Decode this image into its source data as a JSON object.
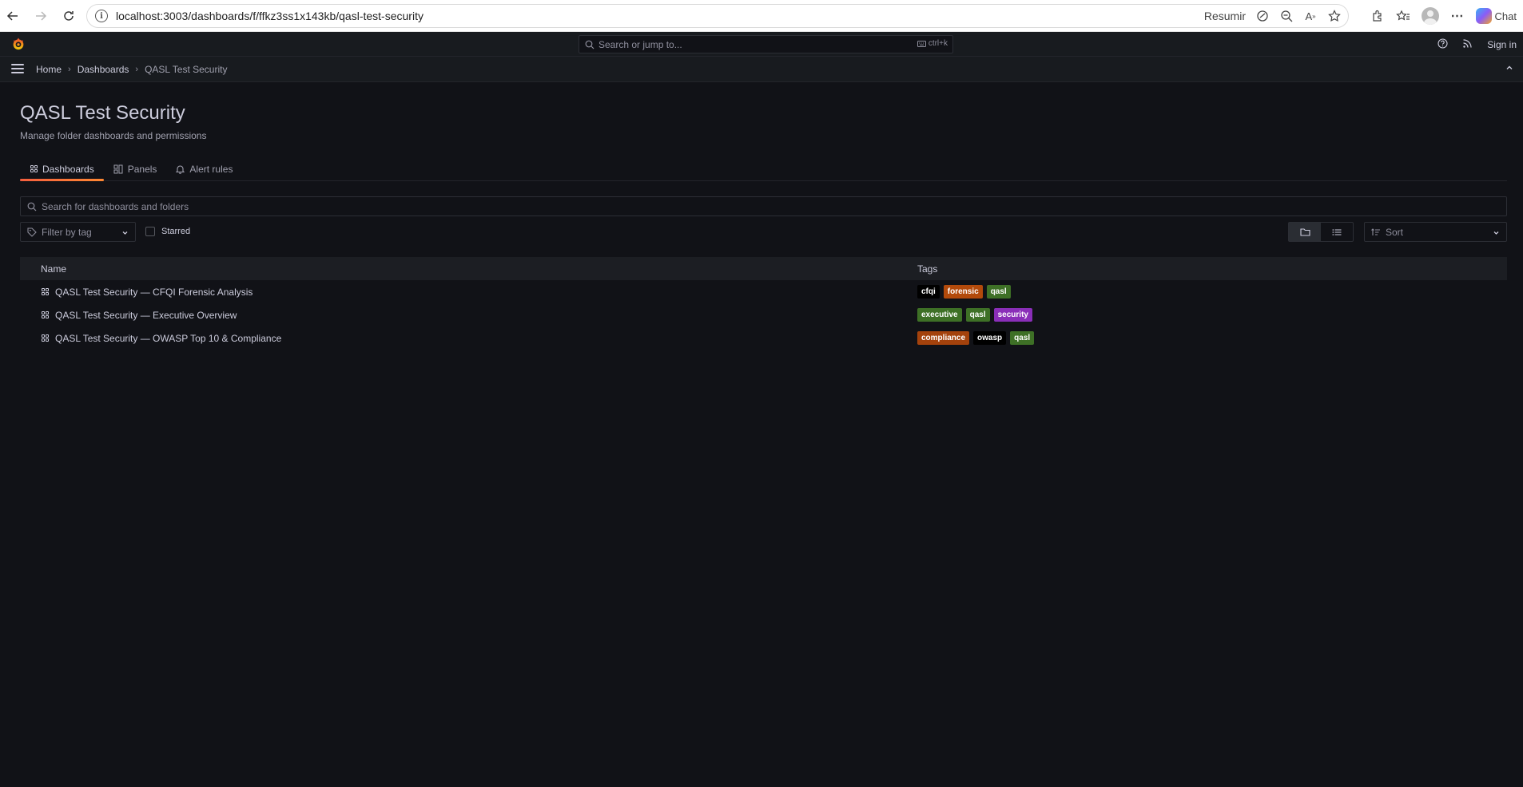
{
  "browser": {
    "url": "localhost:3003/dashboards/f/ffkz3ss1x143kb/qasl-test-security",
    "resumir_label": "Resumir",
    "chat_label": "Chat"
  },
  "topbar": {
    "search_placeholder": "Search or jump to...",
    "shortcut": "ctrl+k",
    "signin_label": "Sign in"
  },
  "breadcrumb": {
    "items": [
      "Home",
      "Dashboards",
      "QASL Test Security"
    ]
  },
  "page": {
    "title": "QASL Test Security",
    "subtitle": "Manage folder dashboards and permissions"
  },
  "tabs": [
    {
      "label": "Dashboards",
      "icon": "apps-icon",
      "active": true
    },
    {
      "label": "Panels",
      "icon": "library-panel-icon",
      "active": false
    },
    {
      "label": "Alert rules",
      "icon": "bell-icon",
      "active": false
    }
  ],
  "filters": {
    "search_placeholder": "Search for dashboards and folders",
    "tag_placeholder": "Filter by tag",
    "starred_label": "Starred",
    "sort_placeholder": "Sort"
  },
  "table": {
    "columns": [
      "Name",
      "Tags"
    ],
    "rows": [
      {
        "name": "QASL Test Security — CFQI Forensic Analysis",
        "tags": [
          {
            "label": "cfqi",
            "color": "#000000"
          },
          {
            "label": "forensic",
            "color": "#b34a0b"
          },
          {
            "label": "qasl",
            "color": "#3e7026"
          }
        ]
      },
      {
        "name": "QASL Test Security — Executive Overview",
        "tags": [
          {
            "label": "executive",
            "color": "#3e7026"
          },
          {
            "label": "qasl",
            "color": "#3e7026"
          },
          {
            "label": "security",
            "color": "#8a2eb8"
          }
        ]
      },
      {
        "name": "QASL Test Security — OWASP Top 10 & Compliance",
        "tags": [
          {
            "label": "compliance",
            "color": "#a4420c"
          },
          {
            "label": "owasp",
            "color": "#000000"
          },
          {
            "label": "qasl",
            "color": "#3e7026"
          }
        ]
      }
    ]
  },
  "colors": {
    "background": "#111217",
    "panel": "#181b1f",
    "accent": "#f55f3e"
  }
}
